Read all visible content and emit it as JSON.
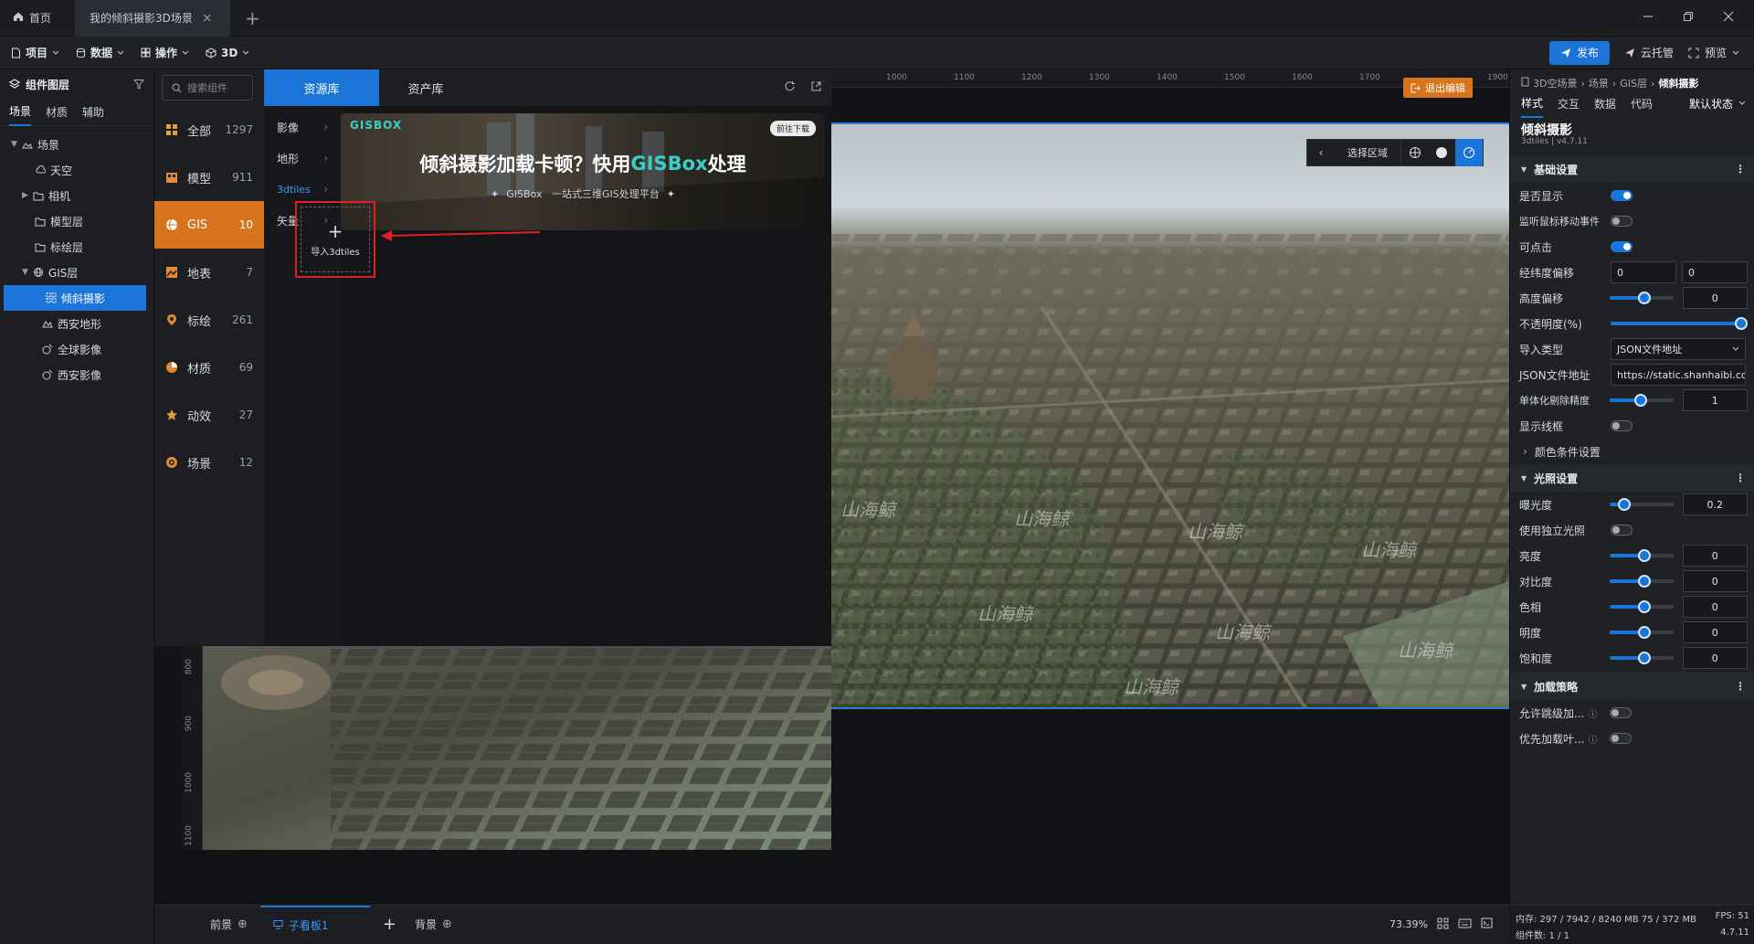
{
  "tabbar": {
    "home_label": "首页",
    "active_tab_label": "我的倾斜摄影3D场景",
    "close_glyph": "×",
    "add_glyph": "+"
  },
  "menubar": {
    "items": [
      {
        "label": "项目",
        "icon": "file-icon"
      },
      {
        "label": "数据",
        "icon": "database-icon"
      },
      {
        "label": "操作",
        "icon": "grid-icon"
      },
      {
        "label": "3D",
        "icon": "cube-icon"
      }
    ],
    "publish_label": "发布",
    "hosting_label": "云托管",
    "preview_label": "预览"
  },
  "leftpanel": {
    "title": "组件图层",
    "tabs": [
      "场景",
      "材质",
      "辅助"
    ],
    "tree": [
      {
        "label": "场景",
        "level": 0,
        "expanded": true,
        "icon": "scene-icon"
      },
      {
        "label": "天空",
        "level": 1,
        "icon": "sky-icon"
      },
      {
        "label": "相机",
        "level": 1,
        "icon": "folder-icon"
      },
      {
        "label": "模型层",
        "level": 1,
        "icon": "folder-icon"
      },
      {
        "label": "标绘层",
        "level": 1,
        "icon": "folder-icon"
      },
      {
        "label": "GIS层",
        "level": 0,
        "expanded": true,
        "icon": "gis-icon"
      },
      {
        "label": "倾斜摄影",
        "level": 1,
        "selected": true,
        "icon": "tiles-icon"
      },
      {
        "label": "西安地形",
        "level": 1,
        "icon": "terrain-icon"
      },
      {
        "label": "全球影像",
        "level": 1,
        "icon": "imagery-icon"
      },
      {
        "label": "西安影像",
        "level": 1,
        "icon": "imagery-icon"
      }
    ]
  },
  "assets": {
    "search_placeholder": "搜索组件",
    "tab_resource": "资源库",
    "tab_assets": "资产库",
    "categories": [
      {
        "label": "全部",
        "count": "1297",
        "icon": "all-icon",
        "color": "#e0a040"
      },
      {
        "label": "模型",
        "count": "911",
        "icon": "model-icon",
        "color": "#e08a3a"
      },
      {
        "label": "GIS",
        "count": "10",
        "icon": "gis-icon",
        "active": true,
        "color": "#ffffff"
      },
      {
        "label": "地表",
        "count": "7",
        "icon": "surface-icon",
        "color": "#e08a3a"
      },
      {
        "label": "标绘",
        "count": "261",
        "icon": "marker-icon",
        "color": "#e08a3a"
      },
      {
        "label": "材质",
        "count": "69",
        "icon": "material-icon",
        "color": "#e08a3a"
      },
      {
        "label": "动效",
        "count": "27",
        "icon": "effect-icon",
        "color": "#e0a040"
      },
      {
        "label": "场景",
        "count": "12",
        "icon": "scene-icon",
        "color": "#e08a3a"
      }
    ],
    "subcategories": [
      {
        "label": "影像"
      },
      {
        "label": "地形"
      },
      {
        "label": "3dtiles",
        "active": true
      },
      {
        "label": "矢量"
      }
    ],
    "banner": {
      "logo": "GISBOX",
      "badge": "前往下载",
      "headline_part1": "倾斜摄影加载卡顿？快用",
      "headline_part2": "GISBox",
      "headline_part3": "处理",
      "subtitle": "GISBox   一站式三维GIS处理平台"
    },
    "import_card_label": "导入3dtiles",
    "import_plus": "+"
  },
  "viewport": {
    "ruler_top": [
      "1000",
      "1100",
      "1200",
      "1300",
      "1400",
      "1500",
      "1600",
      "1700",
      "1900"
    ],
    "ruler_left": [
      "800",
      "900",
      "1000",
      "1100"
    ],
    "exit_edit_label": "退出编辑",
    "select_area_label": "选择区域",
    "watermarks": [
      "山海鲸",
      "山海鲸",
      "山海鲸",
      "山海鲸",
      "山海鲸",
      "山海鲸",
      "山海鲸",
      "山海鲸"
    ],
    "bottom": {
      "front_label": "前景",
      "sub_board_label": "子看板1",
      "back_label": "背景",
      "zoom": "73.39%"
    }
  },
  "rightpanel": {
    "breadcrumb": [
      "3D空场景",
      "场景",
      "GIS层",
      "倾斜摄影"
    ],
    "tabs": [
      "样式",
      "交互",
      "数据",
      "代码"
    ],
    "state_select": "默认状态",
    "component_title": "倾斜摄影",
    "component_sub": "3dtiles | v4.7.11",
    "sections": {
      "basic": "基础设置",
      "lighting": "光照设置",
      "loading": "加载策略",
      "color_cond": "颜色条件设置"
    },
    "basic": {
      "visible": "是否显示",
      "mouse_move": "监听鼠标移动事件",
      "clickable": "可点击",
      "lnglat_offset": "经纬度偏移",
      "lnglat_val1": "0",
      "lnglat_val2": "0",
      "height_offset": "高度偏移",
      "height_val": "0",
      "opacity": "不透明度(%)",
      "import_type": "导入类型",
      "import_type_val": "JSON文件地址",
      "json_url": "JSON文件地址",
      "json_url_val": "https://static.shanhaibi.co",
      "mono_precision": "单体化剔除精度",
      "mono_val": "1",
      "wireframe": "显示线框"
    },
    "lighting": {
      "exposure": "曝光度",
      "exposure_val": "0.2",
      "independent": "使用独立光照",
      "brightness": "亮度",
      "brightness_val": "0",
      "contrast": "对比度",
      "contrast_val": "0",
      "hue": "色相",
      "hue_val": "0",
      "lightness": "明度",
      "lightness_val": "0",
      "saturation": "饱和度",
      "saturation_val": "0"
    },
    "loading": {
      "allow_skip": "允许跳级加...",
      "prefer_leaf": "优先加载叶..."
    },
    "status": {
      "memory": "内存:  297 / 7942 / 8240 MB  75 / 372 MB",
      "fps": "FPS:  51",
      "components": "组件数: 1 / 1",
      "version": "4.7.11"
    }
  }
}
